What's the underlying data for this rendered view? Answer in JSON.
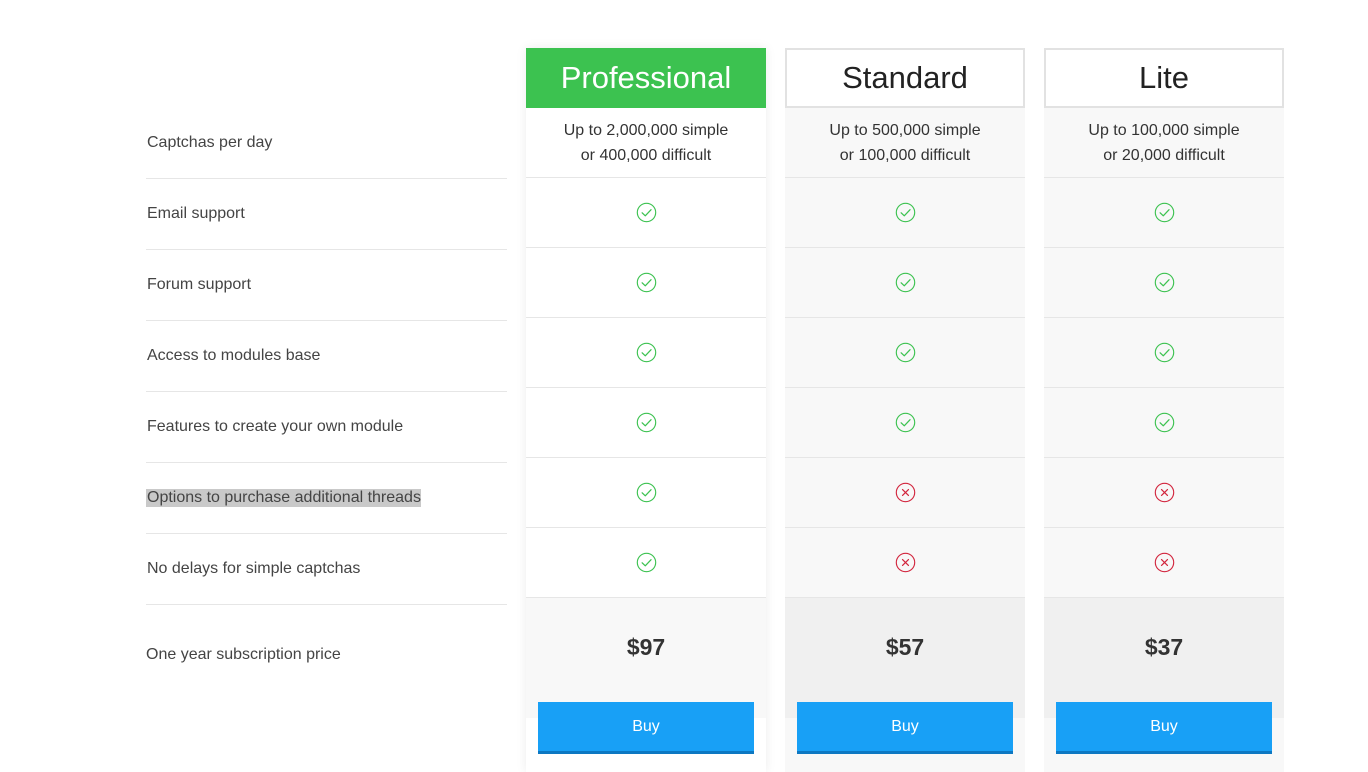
{
  "features": [
    {
      "label": "Captchas per day"
    },
    {
      "label": "Email support"
    },
    {
      "label": "Forum support"
    },
    {
      "label": "Access to modules base"
    },
    {
      "label": "Features to create your own module"
    },
    {
      "label": "Options to purchase additional threads"
    },
    {
      "label": "No delays for simple captchas"
    }
  ],
  "price_label": "One year subscription price",
  "plans": [
    {
      "name": "Professional",
      "captchas_line1": "Up to 2,000,000 simple",
      "captchas_line2": "or 400,000 difficult",
      "support": [
        "yes",
        "yes",
        "yes",
        "yes",
        "yes",
        "yes"
      ],
      "price": "$97",
      "buy_label": "Buy"
    },
    {
      "name": "Standard",
      "captchas_line1": "Up to 500,000 simple",
      "captchas_line2": "or 100,000 difficult",
      "support": [
        "yes",
        "yes",
        "yes",
        "yes",
        "no",
        "no"
      ],
      "price": "$57",
      "buy_label": "Buy"
    },
    {
      "name": "Lite",
      "captchas_line1": "Up to 100,000 simple",
      "captchas_line2": "or 20,000 difficult",
      "support": [
        "yes",
        "yes",
        "yes",
        "yes",
        "no",
        "no"
      ],
      "price": "$37",
      "buy_label": "Buy"
    }
  ],
  "icons": {
    "yes": "check-circle-icon",
    "no": "cross-circle-icon"
  },
  "colors": {
    "accent_green": "#3cc250",
    "check": "#3cc250",
    "cross": "#d2263e",
    "button": "#18a0f6"
  }
}
